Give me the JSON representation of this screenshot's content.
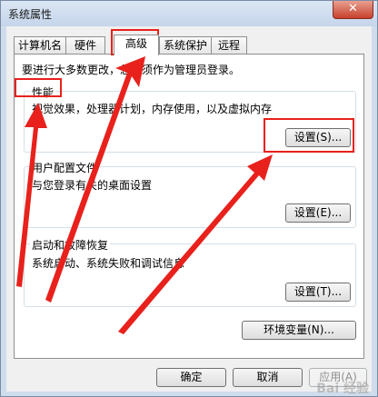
{
  "window": {
    "title": "系统属性",
    "close_glyph": "✕"
  },
  "tabs": [
    {
      "label": "计算机名"
    },
    {
      "label": "硬件"
    },
    {
      "label": "高级"
    },
    {
      "label": "系统保护"
    },
    {
      "label": "远程"
    }
  ],
  "note": "要进行大多数更改，您必须作为管理员登录。",
  "performance": {
    "title": "性能",
    "desc": "视觉效果，处理器计划，内存使用，以及虚拟内存",
    "button": "设置(S)..."
  },
  "user_profiles": {
    "title": "用户配置文件",
    "desc": "与您登录有关的桌面设置",
    "button": "设置(E)..."
  },
  "startup_recovery": {
    "title": "启动和故障恢复",
    "desc": "系统启动、系统失败和调试信息",
    "button": "设置(T)..."
  },
  "env_button": "环境变量(N)...",
  "footer": {
    "ok": "确定",
    "cancel": "取消",
    "apply": "应用(A)"
  },
  "watermark": "Bai 经验",
  "annotation_color": "#e8211c"
}
